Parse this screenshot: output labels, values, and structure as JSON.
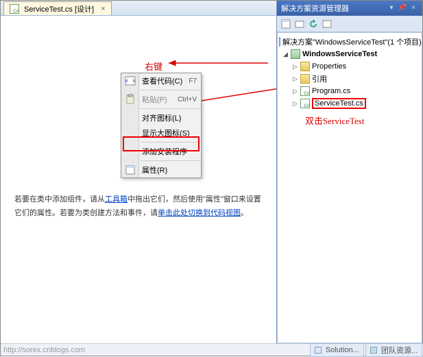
{
  "tab": {
    "title": "ServiceTest.cs [设计]",
    "close": "×"
  },
  "annotations": {
    "right_click": "右键",
    "double_click": "双击ServiceTest"
  },
  "context_menu": {
    "view_code": "查看代码(C)",
    "view_code_key": "F7",
    "paste": "粘贴(P)",
    "paste_key": "Ctrl+V",
    "align_icons": "对齐图标(L)",
    "show_large": "显示大图标(S)",
    "add_installer": "添加安装程序",
    "properties": "属性(R)"
  },
  "help": {
    "line1_a": "若要在类中添加组件，请从",
    "toolbox": "工具箱",
    "line1_b": "中拖出它们，然后使用\"属性\"窗口来设置它们的属性。若要为类创建方法和事件，请",
    "switch_link": "单击此处切换到代码视图",
    "period": "。"
  },
  "solution_explorer": {
    "title": "解决方案资源管理器",
    "solution": "解决方案\"WindowsServiceTest\"(1 个项目)",
    "project": "WindowsServiceTest",
    "properties": "Properties",
    "references": "引用",
    "program": "Program.cs",
    "service_test": "ServiceTest.cs"
  },
  "footer": {
    "url": "http://sorex.cnblogs.com",
    "tab1": "Solution...",
    "tab2": "团队资源..."
  }
}
